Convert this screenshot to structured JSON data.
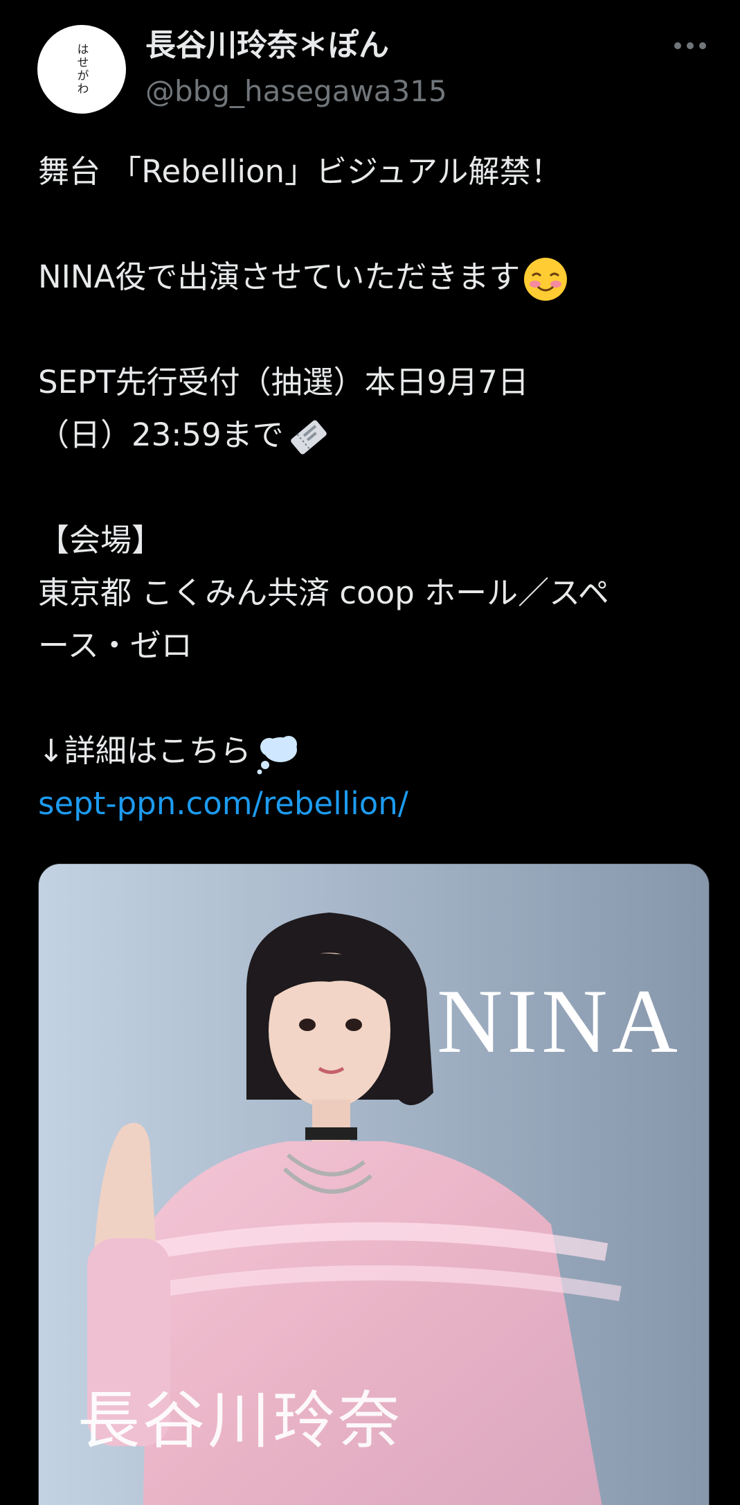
{
  "tweet": {
    "avatar_text": "はせがわ",
    "display_name": "長谷川玲奈＊ぽん",
    "handle": "@bbg_hasegawa315",
    "more_icon": "more-dots-icon",
    "lines": {
      "l1": "舞台 「Rebellion」ビジュアル解禁！",
      "l2": "NINA役で出演させていただきます",
      "l3": "SEPT先行受付（抽選）本日9月7日",
      "l4": "（日）23:59まで",
      "l5": "【会場】",
      "l6": "東京都 こくみん共済 coop ホール／スペ",
      "l7": "ース・ゼロ",
      "l8": "↓詳細はこちら",
      "link": "sept-ppn.com/rebellion/"
    },
    "emoji": {
      "smile": "smiling-blush-face-icon",
      "ticket": "ticket-icon",
      "thought": "thought-balloon-icon"
    }
  },
  "media": {
    "overlay_role": "NINA",
    "overlay_name": "長谷川玲奈"
  }
}
